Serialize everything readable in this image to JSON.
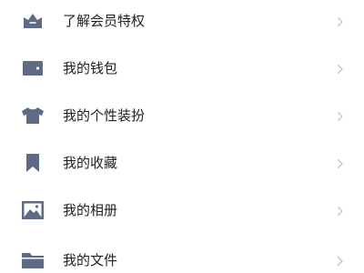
{
  "colors": {
    "icon": "#5f6b85",
    "text": "#222222",
    "chevron": "#c4c4c4",
    "background": "#ffffff"
  },
  "menu": {
    "items": [
      {
        "label": "了解会员特权",
        "icon": "crown-icon"
      },
      {
        "label": "我的钱包",
        "icon": "wallet-icon"
      },
      {
        "label": "我的个性装扮",
        "icon": "shirt-icon"
      },
      {
        "label": "我的收藏",
        "icon": "bookmark-icon"
      },
      {
        "label": "我的相册",
        "icon": "image-icon"
      },
      {
        "label": "我的文件",
        "icon": "folder-icon"
      }
    ]
  }
}
